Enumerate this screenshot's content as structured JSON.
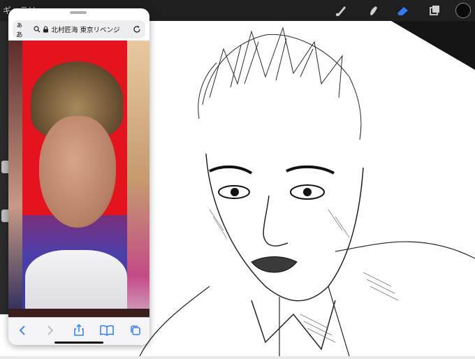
{
  "toolbar": {
    "gallery_label": "ギャラリー",
    "tools": [
      "brush-icon",
      "smudge-icon",
      "eraser-icon",
      "layers-icon"
    ],
    "active_tool": "eraser-icon",
    "active_color": "#0a0a0a",
    "accent_color": "#2f7cf6"
  },
  "safari": {
    "aa_label": "ぁあ",
    "url": "北村匠海 東京リベンジ",
    "icons": {
      "search": "search-icon",
      "lock": "lock-icon",
      "reload": "reload-icon",
      "back": "back-icon",
      "forward": "forward-icon",
      "share": "share-icon",
      "bookmarks": "bookmarks-icon",
      "tabs": "tabs-icon"
    }
  }
}
